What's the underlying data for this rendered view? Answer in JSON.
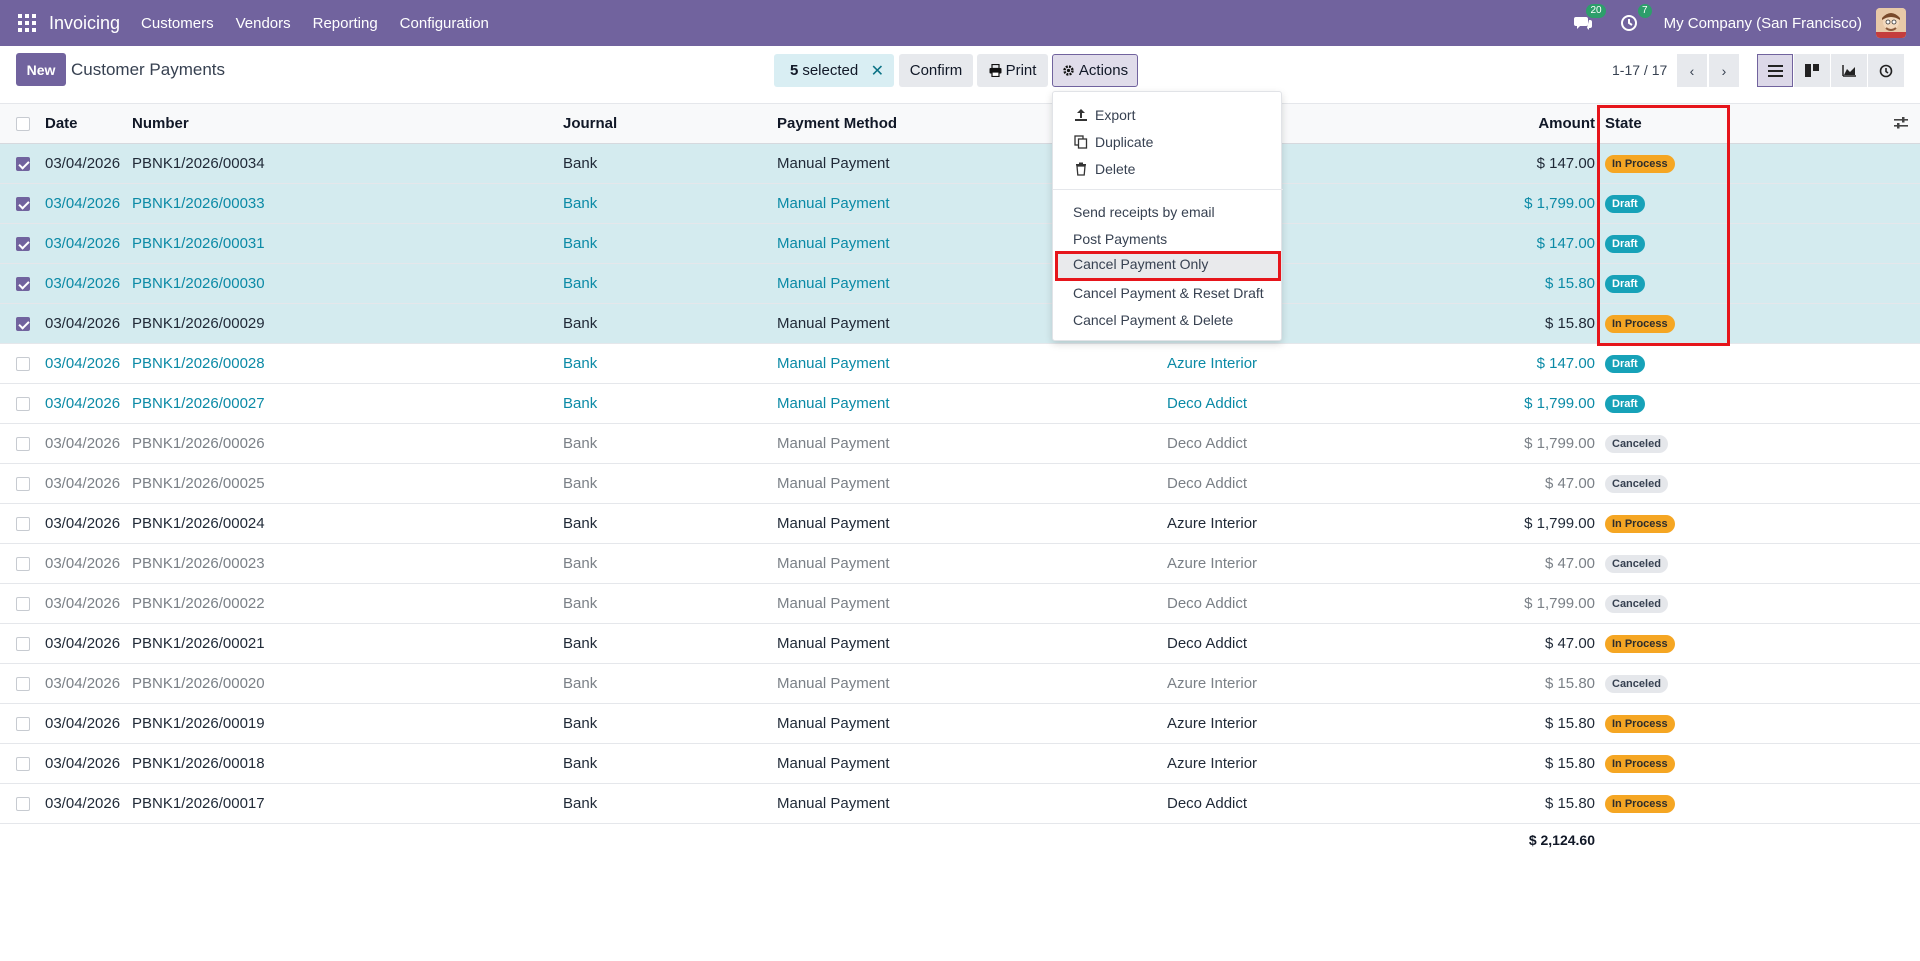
{
  "navbar": {
    "brand": "Invoicing",
    "menu": [
      "Customers",
      "Vendors",
      "Reporting",
      "Configuration"
    ],
    "messages_count": "20",
    "activities_count": "7",
    "company": "My Company (San Francisco)"
  },
  "control": {
    "new_label": "New",
    "title": "Customer Payments",
    "selected_count": "5",
    "selected_label": "selected",
    "confirm_label": "Confirm",
    "print_label": "Print",
    "actions_label": "Actions",
    "pager": "1-17 / 17"
  },
  "actions_menu": {
    "export": "Export",
    "duplicate": "Duplicate",
    "delete": "Delete",
    "send_receipts": "Send receipts by email",
    "post_payments": "Post Payments",
    "cancel_only": "Cancel Payment Only",
    "cancel_reset": "Cancel Payment & Reset Draft",
    "cancel_delete": "Cancel Payment & Delete"
  },
  "table": {
    "headers": {
      "date": "Date",
      "number": "Number",
      "journal": "Journal",
      "method": "Payment Method",
      "amount": "Amount",
      "state": "State"
    },
    "rows": [
      {
        "date": "03/04/2026",
        "number": "PBNK1/2026/00034",
        "journal": "Bank",
        "method": "Manual Payment",
        "customer": "",
        "amount": "$ 147.00",
        "state": "In Process"
      },
      {
        "date": "03/04/2026",
        "number": "PBNK1/2026/00033",
        "journal": "Bank",
        "method": "Manual Payment",
        "customer": "",
        "amount": "$ 1,799.00",
        "state": "Draft"
      },
      {
        "date": "03/04/2026",
        "number": "PBNK1/2026/00031",
        "journal": "Bank",
        "method": "Manual Payment",
        "customer": "",
        "amount": "$ 147.00",
        "state": "Draft"
      },
      {
        "date": "03/04/2026",
        "number": "PBNK1/2026/00030",
        "journal": "Bank",
        "method": "Manual Payment",
        "customer": "",
        "amount": "$ 15.80",
        "state": "Draft"
      },
      {
        "date": "03/04/2026",
        "number": "PBNK1/2026/00029",
        "journal": "Bank",
        "method": "Manual Payment",
        "customer": "",
        "amount": "$ 15.80",
        "state": "In Process"
      },
      {
        "date": "03/04/2026",
        "number": "PBNK1/2026/00028",
        "journal": "Bank",
        "method": "Manual Payment",
        "customer": "Azure Interior",
        "amount": "$ 147.00",
        "state": "Draft"
      },
      {
        "date": "03/04/2026",
        "number": "PBNK1/2026/00027",
        "journal": "Bank",
        "method": "Manual Payment",
        "customer": "Deco Addict",
        "amount": "$ 1,799.00",
        "state": "Draft"
      },
      {
        "date": "03/04/2026",
        "number": "PBNK1/2026/00026",
        "journal": "Bank",
        "method": "Manual Payment",
        "customer": "Deco Addict",
        "amount": "$ 1,799.00",
        "state": "Canceled"
      },
      {
        "date": "03/04/2026",
        "number": "PBNK1/2026/00025",
        "journal": "Bank",
        "method": "Manual Payment",
        "customer": "Deco Addict",
        "amount": "$ 47.00",
        "state": "Canceled"
      },
      {
        "date": "03/04/2026",
        "number": "PBNK1/2026/00024",
        "journal": "Bank",
        "method": "Manual Payment",
        "customer": "Azure Interior",
        "amount": "$ 1,799.00",
        "state": "In Process"
      },
      {
        "date": "03/04/2026",
        "number": "PBNK1/2026/00023",
        "journal": "Bank",
        "method": "Manual Payment",
        "customer": "Azure Interior",
        "amount": "$ 47.00",
        "state": "Canceled"
      },
      {
        "date": "03/04/2026",
        "number": "PBNK1/2026/00022",
        "journal": "Bank",
        "method": "Manual Payment",
        "customer": "Deco Addict",
        "amount": "$ 1,799.00",
        "state": "Canceled"
      },
      {
        "date": "03/04/2026",
        "number": "PBNK1/2026/00021",
        "journal": "Bank",
        "method": "Manual Payment",
        "customer": "Deco Addict",
        "amount": "$ 47.00",
        "state": "In Process"
      },
      {
        "date": "03/04/2026",
        "number": "PBNK1/2026/00020",
        "journal": "Bank",
        "method": "Manual Payment",
        "customer": "Azure Interior",
        "amount": "$ 15.80",
        "state": "Canceled"
      },
      {
        "date": "03/04/2026",
        "number": "PBNK1/2026/00019",
        "journal": "Bank",
        "method": "Manual Payment",
        "customer": "Azure Interior",
        "amount": "$ 15.80",
        "state": "In Process"
      },
      {
        "date": "03/04/2026",
        "number": "PBNK1/2026/00018",
        "journal": "Bank",
        "method": "Manual Payment",
        "customer": "Azure Interior",
        "amount": "$ 15.80",
        "state": "In Process"
      },
      {
        "date": "03/04/2026",
        "number": "PBNK1/2026/00017",
        "journal": "Bank",
        "method": "Manual Payment",
        "customer": "Deco Addict",
        "amount": "$ 15.80",
        "state": "In Process"
      }
    ],
    "total": "$ 2,124.60"
  },
  "colors": {
    "brand": "#71639e",
    "selected_row": "#d4ebef",
    "link": "#0b8aa6",
    "in_process": "#f5a623",
    "draft": "#17a2b8",
    "highlight": "#e6151b"
  }
}
